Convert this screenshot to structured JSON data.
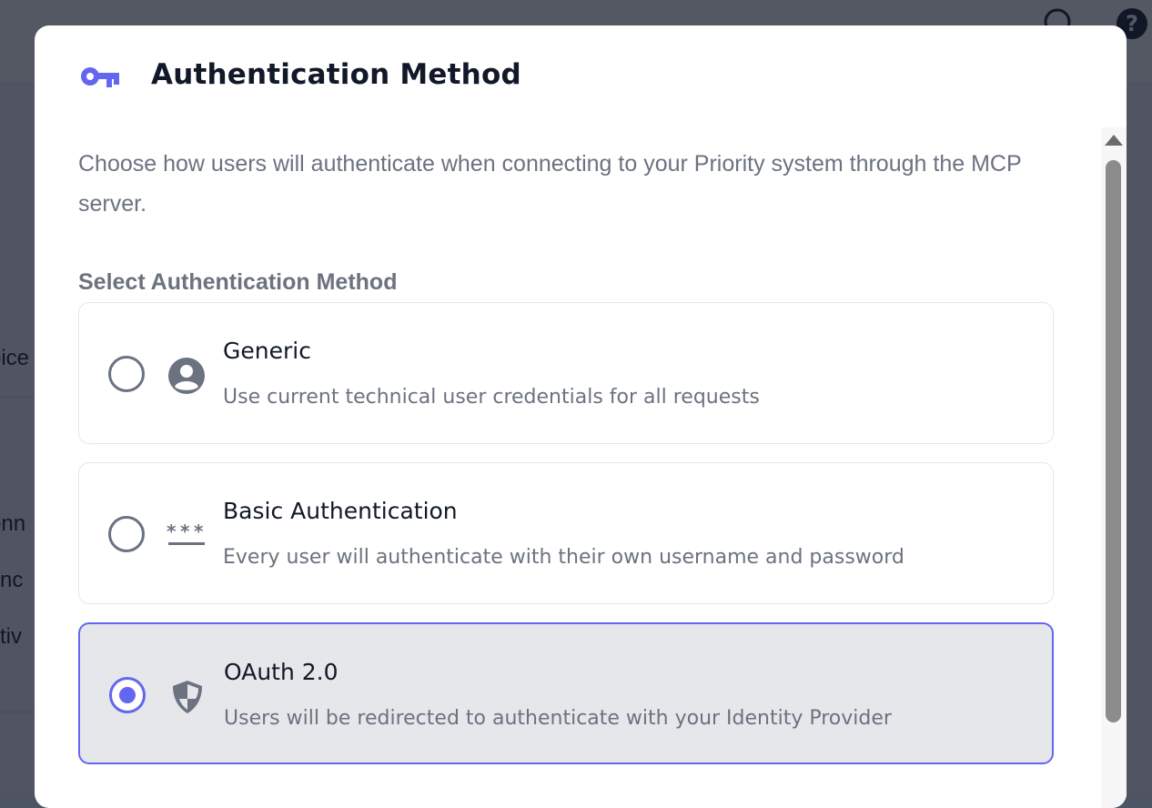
{
  "background": {
    "side_items": [
      "oice",
      "onn",
      "ync",
      "ctiv"
    ]
  },
  "modal": {
    "title": "Authentication Method",
    "description": "Choose how users will authenticate when connecting to your Priority system through the MCP server.",
    "section_label": "Select Authentication Method",
    "options": [
      {
        "title": "Generic",
        "description": "Use current technical user credentials for all requests",
        "icon": "user-circle-icon",
        "selected": false
      },
      {
        "title": "Basic Authentication",
        "description": "Every user will authenticate with their own username and password",
        "icon": "password-icon",
        "selected": false
      },
      {
        "title": "OAuth 2.0",
        "description": "Users will be redirected to authenticate with your Identity Provider",
        "icon": "shield-icon",
        "selected": true
      }
    ]
  },
  "colors": {
    "accent": "#6366f1",
    "title": "#111827",
    "muted": "#6b7280",
    "selected_bg": "#e5e7eb"
  }
}
